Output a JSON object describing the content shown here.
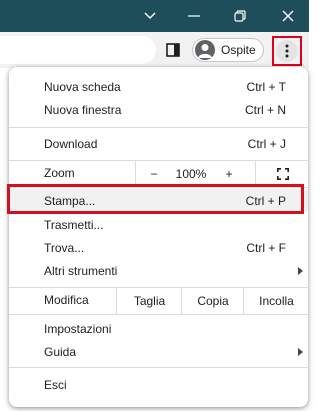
{
  "profile": {
    "label": "Ospite"
  },
  "menu": {
    "new_tab": {
      "label": "Nuova scheda",
      "shortcut": "Ctrl + T"
    },
    "new_window": {
      "label": "Nuova finestra",
      "shortcut": "Ctrl + N"
    },
    "download": {
      "label": "Download",
      "shortcut": "Ctrl + J"
    },
    "zoom": {
      "label": "Zoom",
      "minus": "−",
      "value": "100%",
      "plus": "+"
    },
    "print": {
      "label": "Stampa...",
      "shortcut": "Ctrl + P"
    },
    "cast": {
      "label": "Trasmetti..."
    },
    "find": {
      "label": "Trova...",
      "shortcut": "Ctrl + F"
    },
    "more_tools": {
      "label": "Altri strumenti"
    },
    "edit": {
      "label": "Modifica",
      "cut": "Taglia",
      "copy": "Copia",
      "paste": "Incolla"
    },
    "settings": {
      "label": "Impostazioni"
    },
    "help": {
      "label": "Guida"
    },
    "exit": {
      "label": "Esci"
    }
  },
  "colors": {
    "titlebar": "#1d4e5a",
    "highlight_border": "#d3101e"
  }
}
